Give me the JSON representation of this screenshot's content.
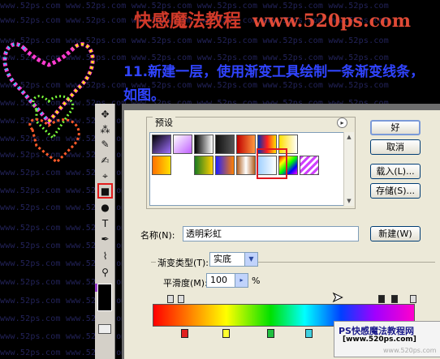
{
  "watermark_lines": [
    "www.52ps.com www.52ps.com www.52ps.com www.52ps.com www.52ps.com www.52ps.com"
  ],
  "banner": {
    "title": "快感魔法教程",
    "url": "www.520ps.com"
  },
  "instruction": {
    "line1": "11.新建一层，使用渐变工具绘制一条渐变线条，",
    "line2": "如图。"
  },
  "tools": [
    {
      "name": "move-tool-icon",
      "glyph": "✥"
    },
    {
      "name": "magic-wand-icon",
      "glyph": "⁂"
    },
    {
      "name": "healing-brush-icon",
      "glyph": "✎"
    },
    {
      "name": "brush-tool-icon",
      "glyph": "✍"
    },
    {
      "name": "history-brush-icon",
      "glyph": "⌖"
    },
    {
      "name": "gradient-tool-icon",
      "glyph": "■"
    },
    {
      "name": "dodge-tool-icon",
      "glyph": "●"
    },
    {
      "name": "type-tool-icon",
      "glyph": "T"
    },
    {
      "name": "pen-tool-icon",
      "glyph": "✒"
    },
    {
      "name": "eyedropper-icon",
      "glyph": "⌇"
    },
    {
      "name": "zoom-tool-icon",
      "glyph": "⚲"
    }
  ],
  "dialog": {
    "presets_label": "预设",
    "preset_menu_glyph": "▸",
    "buttons": {
      "ok": "好",
      "cancel": "取消",
      "load": "载入(L)...",
      "save": "存储(S)...",
      "new": "新建(W)"
    },
    "name_label": "名称(N):",
    "name_value": "透明彩虹",
    "gradient_type_label": "渐变类型(T):",
    "gradient_type_value": "实底",
    "smoothness_label": "平滑度(M):",
    "smoothness_value": "100",
    "smoothness_unit": "%",
    "smoothness_arrow": "▸",
    "dropdown_arrow": "▼"
  },
  "logo": {
    "line1": "PS快感魔法教程网",
    "line2": "[www.520ps.com]",
    "line3": "www.520ps.com"
  },
  "colors": {
    "banner_red": "#d23a2a",
    "instruction_blue": "#3044ff",
    "highlight_red": "#e0171f"
  }
}
